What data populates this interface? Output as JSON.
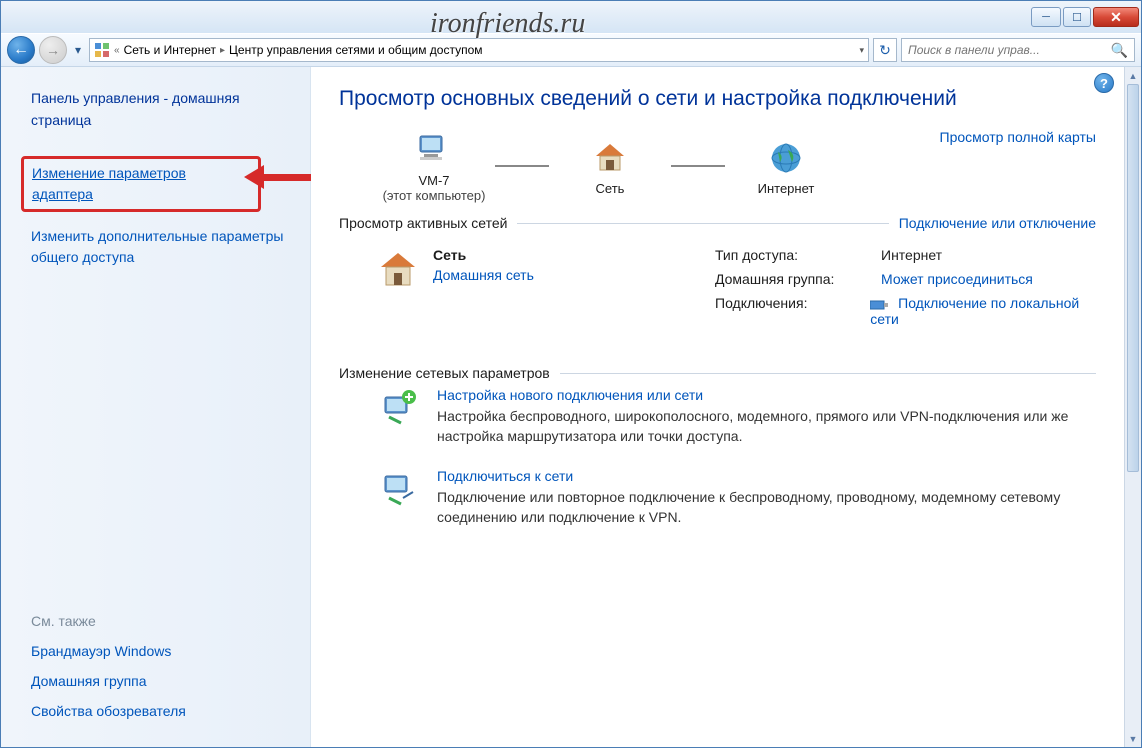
{
  "watermark": "ironfriends.ru",
  "window_buttons": {
    "minimize": "─",
    "maximize": "☐",
    "close": "✕"
  },
  "navbar": {
    "back_glyph": "←",
    "fwd_glyph": "→",
    "drop_glyph": "▾",
    "refresh_glyph": "↻",
    "breadcrumb": {
      "sep1": "«",
      "level1": "Сеть и Интернет",
      "sep2": "▸",
      "level2": "Центр управления сетями и общим доступом",
      "dropmark": "▾"
    },
    "search_placeholder": "Поиск в панели управ...",
    "search_glyph": "🔍"
  },
  "sidebar": {
    "home": "Панель управления - домашняя страница",
    "link_adapter": "Изменение параметров адаптера",
    "link_sharing": "Изменить дополнительные параметры общего доступа",
    "see_also_hdr": "См. также",
    "see_also": {
      "firewall": "Брандмауэр Windows",
      "homegroup": "Домашняя группа",
      "inetopts": "Свойства обозревателя"
    }
  },
  "main": {
    "help_glyph": "?",
    "heading": "Просмотр основных сведений о сети и настройка подключений",
    "netmap": {
      "node1_label": "VM-7",
      "node1_sub": "(этот компьютер)",
      "node2_label": "Сеть",
      "node3_label": "Интернет",
      "fullmap": "Просмотр полной карты"
    },
    "active_section": {
      "title": "Просмотр активных сетей",
      "action": "Подключение или отключение",
      "net_name": "Сеть",
      "net_type": "Домашняя сеть",
      "rows": {
        "access_k": "Тип доступа:",
        "access_v": "Интернет",
        "homegroup_k": "Домашняя группа:",
        "homegroup_v": "Может присоединиться",
        "conn_k": "Подключения:",
        "conn_v": "Подключение по локальной сети"
      }
    },
    "change_section": {
      "title": "Изменение сетевых параметров",
      "item1_title": "Настройка нового подключения или сети",
      "item1_desc": "Настройка беспроводного, широкополосного, модемного, прямого или VPN-подключения или же настройка маршрутизатора или точки доступа.",
      "item2_title": "Подключиться к сети",
      "item2_desc": "Подключение или повторное подключение к беспроводному, проводному, модемному сетевому соединению или подключение к VPN."
    }
  }
}
